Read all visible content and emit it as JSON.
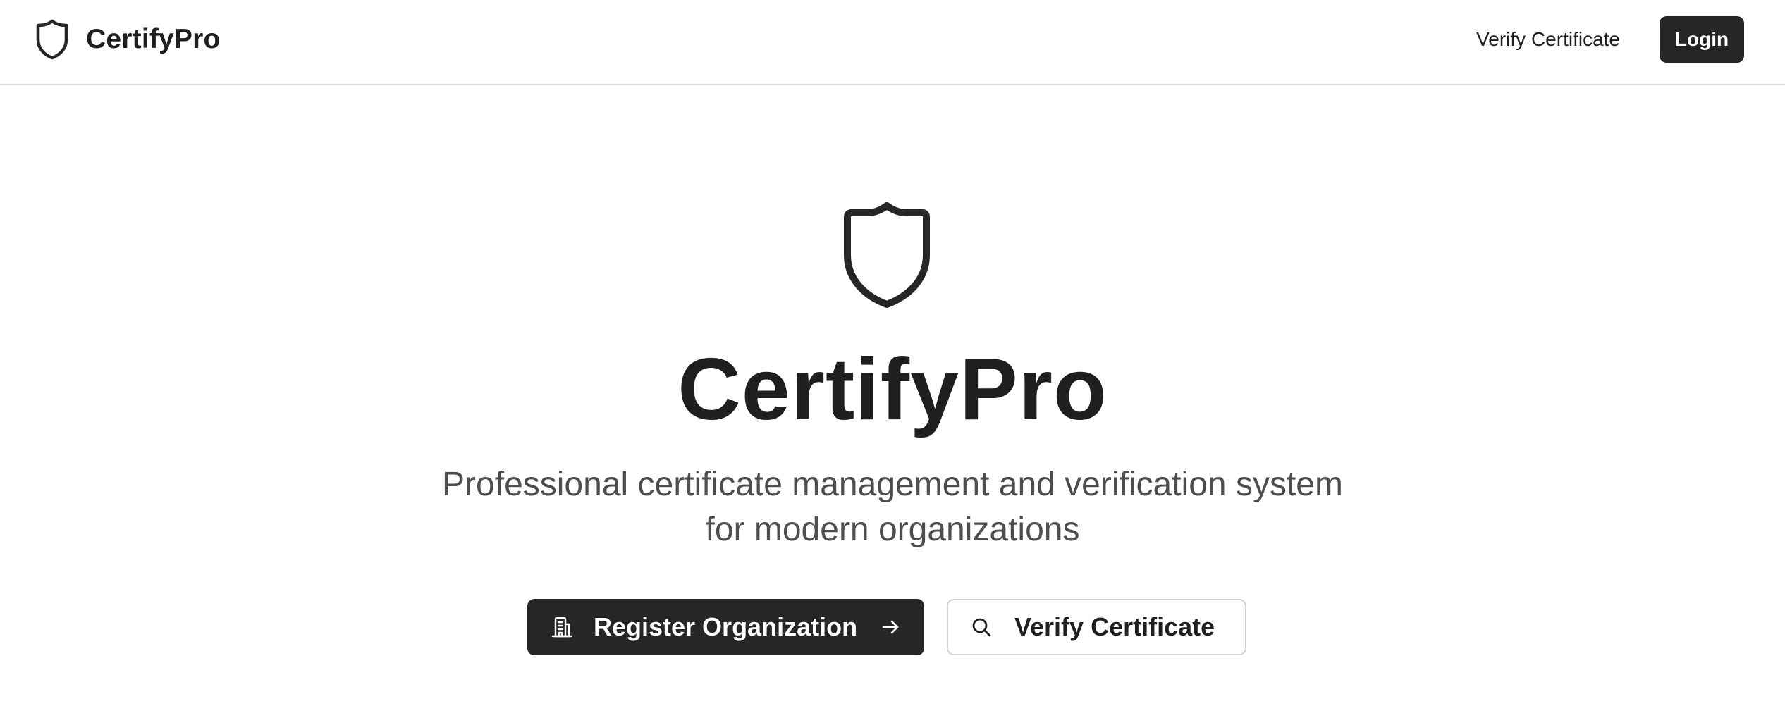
{
  "header": {
    "brand_name": "CertifyPro",
    "brand_icon": "shield-icon",
    "nav_verify_label": "Verify Certificate",
    "login_label": "Login"
  },
  "hero": {
    "icon": "shield-icon",
    "title": "CertifyPro",
    "subtitle": "Professional certificate management and verification system for modern organizations",
    "primary_button": {
      "label": "Register Organization",
      "icon": "building-icon",
      "trailing_icon": "arrow-right-icon"
    },
    "secondary_button": {
      "label": "Verify Certificate",
      "icon": "search-icon"
    }
  },
  "colors": {
    "primary_dark": "#262626",
    "text": "#1f1f1f",
    "muted_text": "#4d4d4d",
    "border": "#d4d4d4"
  }
}
